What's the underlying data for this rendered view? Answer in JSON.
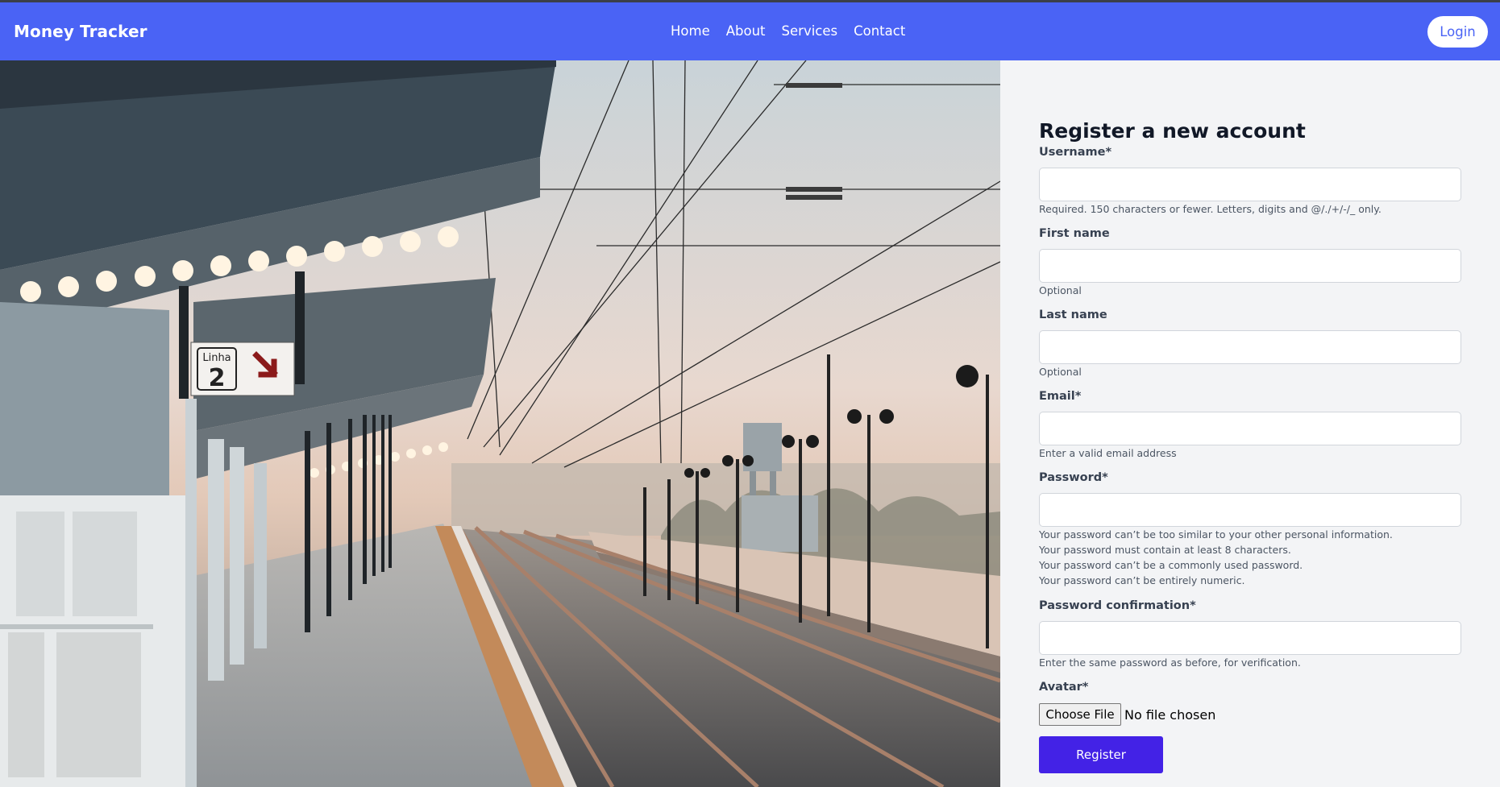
{
  "nav": {
    "brand": "Money Tracker",
    "links": [
      "Home",
      "About",
      "Services",
      "Contact"
    ],
    "login_label": "Login"
  },
  "hero": {
    "sign_line_label": "Linha",
    "sign_line_number": "2"
  },
  "form": {
    "title": "Register a new account",
    "username": {
      "label": "Username*",
      "value": "",
      "help": "Required. 150 characters or fewer. Letters, digits and @/./+/-/_ only."
    },
    "first_name": {
      "label": "First name",
      "value": "",
      "help": "Optional"
    },
    "last_name": {
      "label": "Last name",
      "value": "",
      "help": "Optional"
    },
    "email": {
      "label": "Email*",
      "value": "",
      "help": "Enter a valid email address"
    },
    "password": {
      "label": "Password*",
      "value": "",
      "help": [
        "Your password can’t be too similar to your other personal information.",
        "Your password must contain at least 8 characters.",
        "Your password can’t be a commonly used password.",
        "Your password can’t be entirely numeric."
      ]
    },
    "password_confirmation": {
      "label": "Password confirmation*",
      "value": "",
      "help": "Enter the same password as before, for verification."
    },
    "avatar": {
      "label": "Avatar*",
      "button_label": "Choose File",
      "status": "No file chosen"
    },
    "submit_label": "Register"
  },
  "colors": {
    "navbar": "#4a63f5",
    "panel": "#f3f4f6",
    "register_button": "#4322e6"
  }
}
